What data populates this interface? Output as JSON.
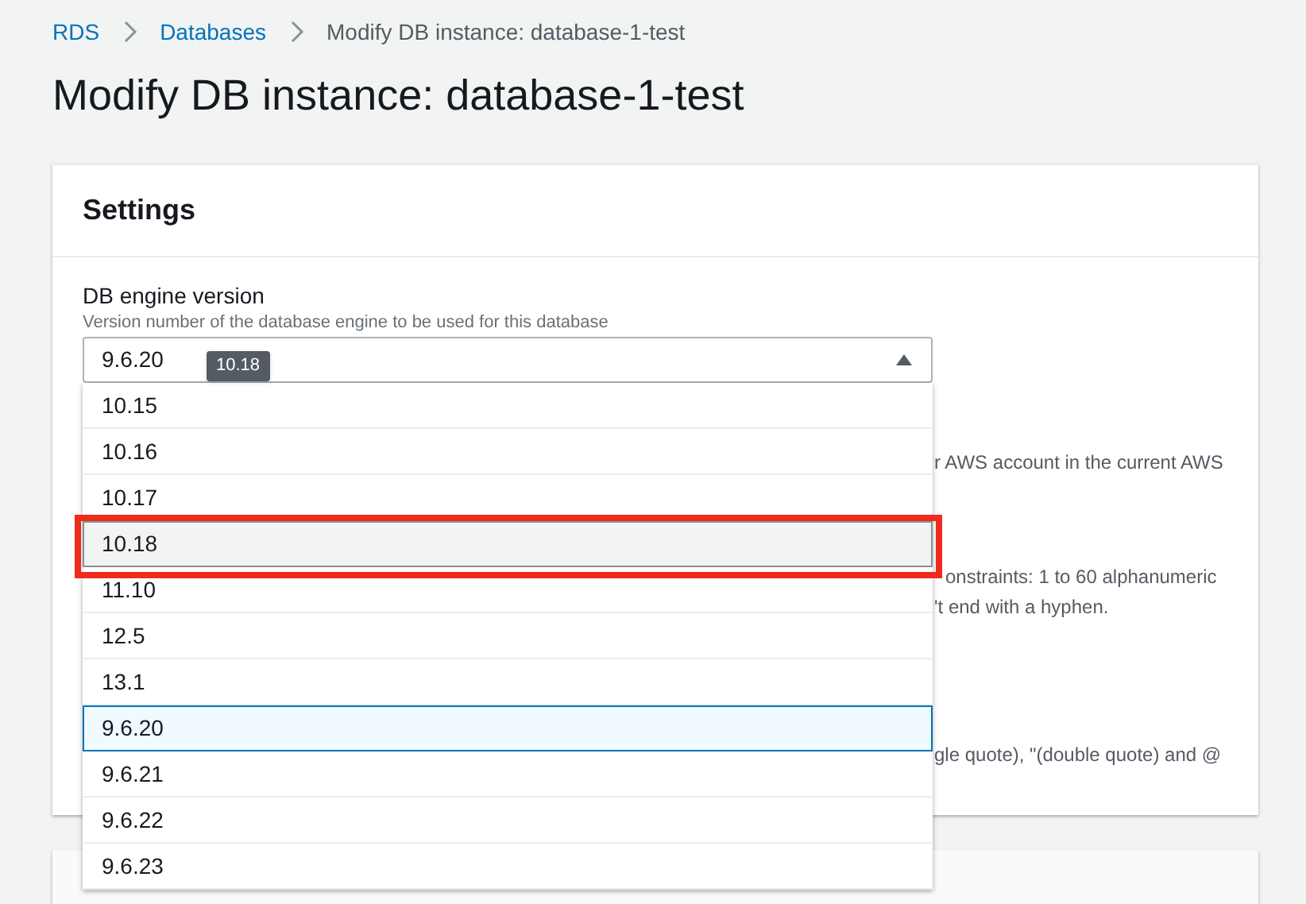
{
  "breadcrumb": [
    {
      "label": "RDS",
      "kind": "link"
    },
    {
      "label": "Databases",
      "kind": "link"
    },
    {
      "label": "Modify DB instance: database-1-test",
      "kind": "current"
    }
  ],
  "title": "Modify DB instance: database-1-test",
  "settings": {
    "heading": "Settings",
    "engine_version": {
      "label": "DB engine version",
      "description": "Version number of the database engine to be used for this database",
      "value": "9.6.20",
      "expanded": true,
      "tooltip": "10.18",
      "options": [
        {
          "label": "10.15",
          "selected": false,
          "hovered": false,
          "highlighted": false
        },
        {
          "label": "10.16",
          "selected": false,
          "hovered": false,
          "highlighted": false
        },
        {
          "label": "10.17",
          "selected": false,
          "hovered": false,
          "highlighted": false
        },
        {
          "label": "10.18",
          "selected": false,
          "hovered": true,
          "highlighted": true
        },
        {
          "label": "11.10",
          "selected": false,
          "hovered": false,
          "highlighted": false
        },
        {
          "label": "12.5",
          "selected": false,
          "hovered": false,
          "highlighted": false
        },
        {
          "label": "13.1",
          "selected": false,
          "hovered": false,
          "highlighted": false
        },
        {
          "label": "9.6.20",
          "selected": true,
          "hovered": false,
          "highlighted": false
        },
        {
          "label": "9.6.21",
          "selected": false,
          "hovered": false,
          "highlighted": false
        },
        {
          "label": "9.6.22",
          "selected": false,
          "hovered": false,
          "highlighted": false
        },
        {
          "label": "9.6.23",
          "selected": false,
          "hovered": false,
          "highlighted": false
        }
      ]
    },
    "hidden_text_fragments": [
      "r AWS account in the current AWS",
      "onstraints: 1 to 60 alphanumeric",
      "'t end with a hyphen.",
      "gle quote), \"(double quote) and @"
    ]
  }
}
